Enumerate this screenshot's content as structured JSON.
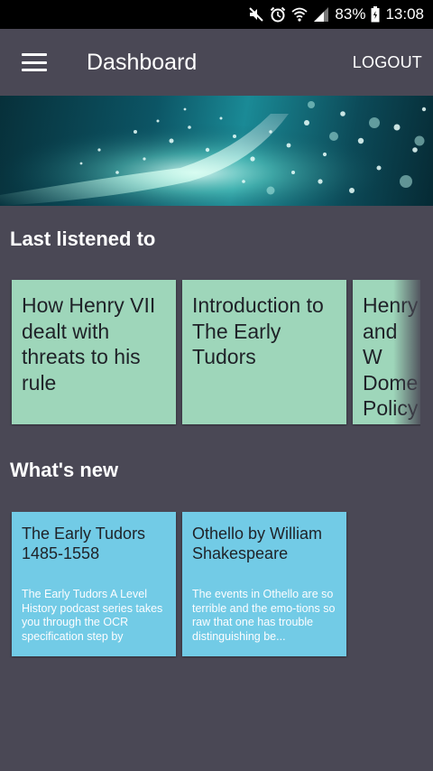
{
  "status_bar": {
    "battery": "83%",
    "time": "13:08",
    "icons": [
      "mute-icon",
      "alarm-icon",
      "wifi-icon",
      "signal-icon",
      "battery-icon"
    ]
  },
  "app_bar": {
    "title": "Dashboard",
    "logout_label": "LOGOUT",
    "menu_icon": "hamburger-menu-icon"
  },
  "sections": {
    "last_listened": {
      "title": "Last listened to",
      "cards": [
        {
          "title": "How Henry VII dealt with threats to his rule"
        },
        {
          "title": "Introduction to The Early Tudors"
        },
        {
          "title": "Henry and W Dome Policy"
        }
      ]
    },
    "whats_new": {
      "title": "What's new",
      "cards": [
        {
          "title": "The Early Tudors 1485-1558",
          "description": "The Early Tudors A Level History podcast series takes you through the OCR specification step by"
        },
        {
          "title": "Othello by William Shakespeare",
          "description": "The events in Othello are so terrible and the emo-tions so raw that one has trouble distinguishing be..."
        }
      ]
    }
  },
  "colors": {
    "background": "#4a4855",
    "status_bar": "#000000",
    "card_green": "#9ed6ba",
    "card_blue": "#72cbe6",
    "card_title_text": "#1f2228"
  }
}
